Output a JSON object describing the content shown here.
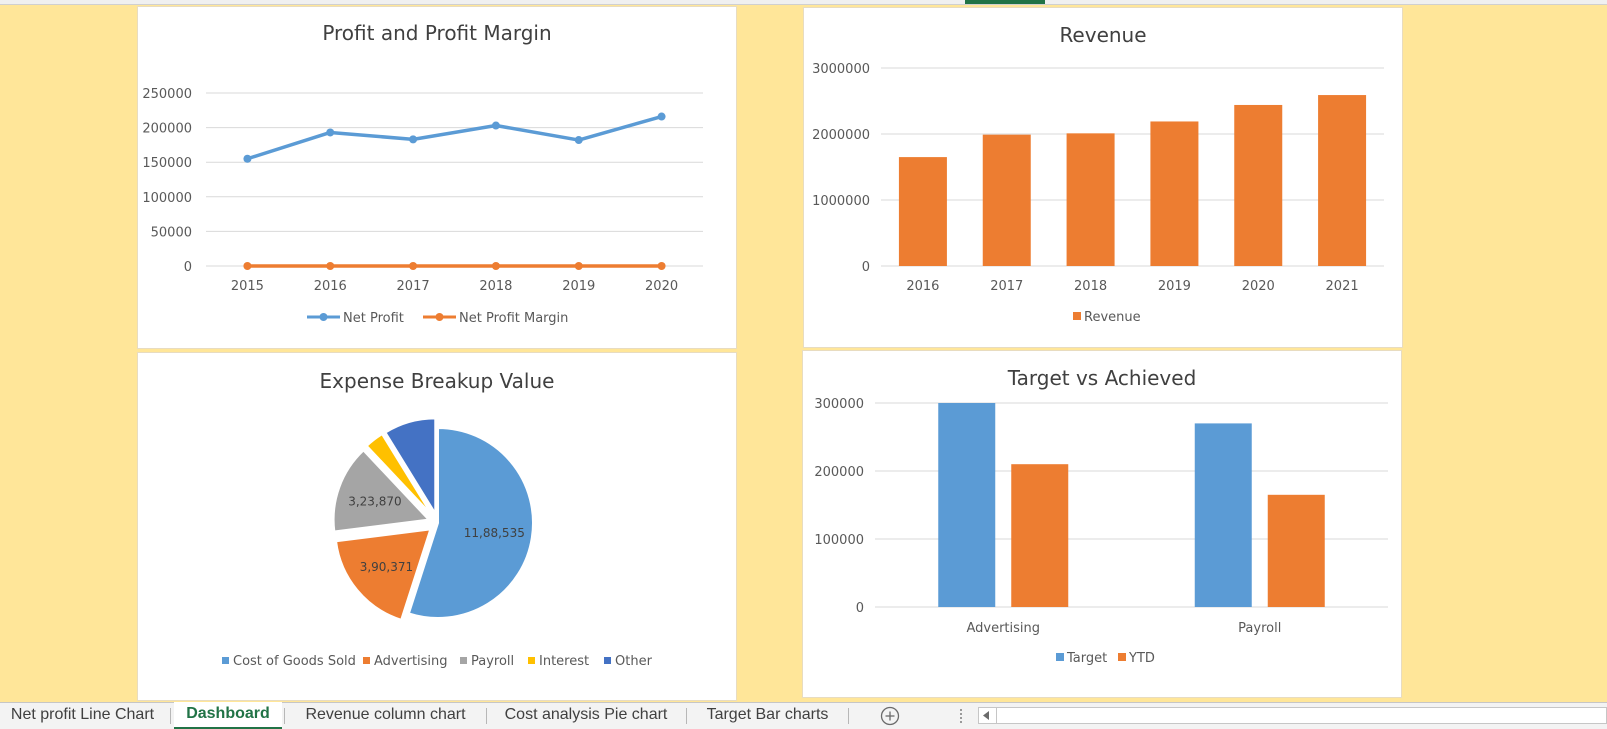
{
  "charts": {
    "profit": {
      "title": "Profit and Profit Margin",
      "yticks": [
        "250000",
        "200000",
        "150000",
        "100000",
        "50000",
        "0"
      ],
      "legend": [
        "Net Profit",
        "Net Profit Margin"
      ]
    },
    "revenue": {
      "title": "Revenue",
      "yticks": [
        "3000000",
        "2000000",
        "1000000",
        "0"
      ],
      "legend": [
        "Revenue"
      ]
    },
    "expense": {
      "title": "Expense Breakup Value",
      "slice_labels": [
        "11,88,535",
        "3,90,371",
        "3,23,870"
      ],
      "legend": [
        "Cost of Goods Sold",
        "Advertising",
        "Payroll",
        "Interest",
        "Other"
      ]
    },
    "target": {
      "title": "Target vs Achieved",
      "yticks": [
        "300000",
        "200000",
        "100000",
        "0"
      ],
      "legend": [
        "Target",
        "YTD"
      ]
    }
  },
  "chart_data": [
    {
      "type": "line",
      "title": "Profit and Profit Margin",
      "x": [
        "2015",
        "2016",
        "2017",
        "2018",
        "2019",
        "2020"
      ],
      "ylim": [
        0,
        250000
      ],
      "series": [
        {
          "name": "Net Profit",
          "values": [
            155000,
            193000,
            183000,
            203000,
            182000,
            216000
          ],
          "color": "#5b9bd5"
        },
        {
          "name": "Net Profit Margin",
          "values": [
            0,
            0,
            0,
            0,
            0,
            0
          ],
          "color": "#ed7d31"
        }
      ],
      "legend": "bottom"
    },
    {
      "type": "bar",
      "title": "Revenue",
      "categories": [
        "2016",
        "2017",
        "2018",
        "2019",
        "2020",
        "2021"
      ],
      "values": [
        1650000,
        1990000,
        2010000,
        2190000,
        2440000,
        2590000
      ],
      "ylim": [
        0,
        3000000
      ],
      "series_name": "Revenue",
      "color": "#ed7d31",
      "legend": "bottom"
    },
    {
      "type": "pie",
      "title": "Expense Breakup Value",
      "categories": [
        "Cost of Goods Sold",
        "Advertising",
        "Payroll",
        "Interest",
        "Other"
      ],
      "values": [
        1188535,
        390371,
        323870,
        70000,
        190000
      ],
      "colors": [
        "#5b9bd5",
        "#ed7d31",
        "#a5a5a5",
        "#ffc000",
        "#4472c4"
      ],
      "legend": "bottom"
    },
    {
      "type": "bar",
      "title": "Target vs Achieved",
      "categories": [
        "Advertising",
        "Payroll"
      ],
      "ylim": [
        0,
        300000
      ],
      "series": [
        {
          "name": "Target",
          "values": [
            300000,
            270000
          ],
          "color": "#5b9bd5"
        },
        {
          "name": "YTD",
          "values": [
            210000,
            165000
          ],
          "color": "#ed7d31"
        }
      ],
      "legend": "bottom"
    }
  ],
  "tabs": [
    {
      "label": "Net profit Line Chart",
      "active": false
    },
    {
      "label": "Dashboard",
      "active": true
    },
    {
      "label": "Revenue column chart",
      "active": false
    },
    {
      "label": "Cost analysis Pie chart",
      "active": false
    },
    {
      "label": "Target Bar charts",
      "active": false
    }
  ],
  "add_sheet_icon": "plus-circle-icon",
  "scroll_left_icon": "triangle-left-icon"
}
